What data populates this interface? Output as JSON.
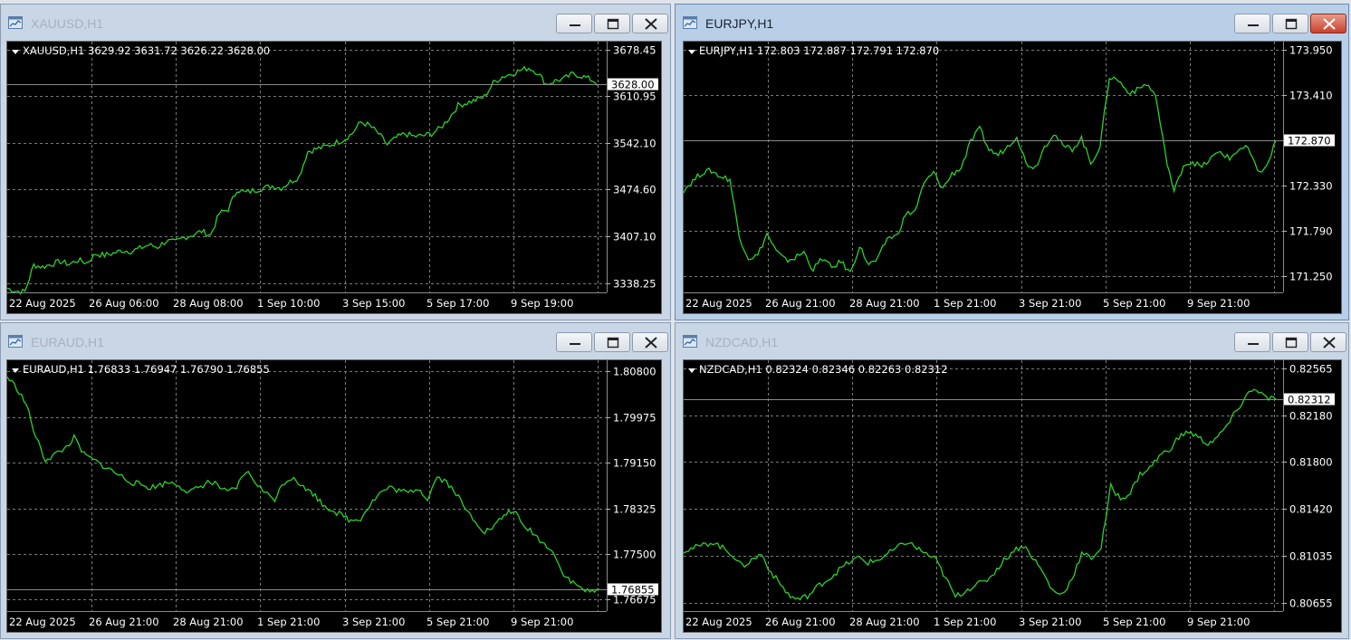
{
  "windows": [
    {
      "id": "xauusd",
      "title": "XAUUSD,H1",
      "active": false,
      "info": "XAUUSD,H1  3629.92 3631.72 3626.22 3628.00",
      "price_axis": [
        "3678.45",
        "3610.95",
        "3542.10",
        "3474.60",
        "3407.10",
        "3338.25"
      ],
      "current_price": "3628.00",
      "time_axis": [
        "22 Aug 2025",
        "26 Aug 06:00",
        "28 Aug 08:00",
        "1 Sep 10:00",
        "3 Sep 15:00",
        "5 Sep 17:00",
        "9 Sep 19:00"
      ],
      "chart_data": {
        "type": "line",
        "series": [
          {
            "values": [
              3331,
              3327,
              3326,
              3365,
              3362,
              3366,
              3370,
              3366,
              3372,
              3368,
              3381,
              3379,
              3382,
              3386,
              3385,
              3389,
              3394,
              3391,
              3400,
              3398,
              3405,
              3409,
              3414,
              3408,
              3440,
              3446,
              3475,
              3470,
              3474,
              3477,
              3480,
              3477,
              3486,
              3493,
              3530,
              3534,
              3537,
              3542,
              3547,
              3556,
              3573,
              3568,
              3556,
              3540,
              3550,
              3556,
              3552,
              3553,
              3556,
              3564,
              3579,
              3597,
              3601,
              3605,
              3610,
              3630,
              3639,
              3643,
              3648,
              3652,
              3645,
              3628,
              3633,
              3636,
              3643,
              3640,
              3635,
              3628
            ]
          }
        ],
        "ylim": [
          3325,
          3690
        ]
      }
    },
    {
      "id": "eurjpy",
      "title": "EURJPY,H1",
      "active": true,
      "info": "EURJPY,H1  172.803 172.887 172.791 172.870",
      "price_axis": [
        "173.950",
        "173.410",
        "172.870",
        "172.330",
        "171.790",
        "171.250"
      ],
      "current_price": "172.870",
      "time_axis": [
        "22 Aug 2025",
        "26 Aug 21:00",
        "28 Aug 21:00",
        "1 Sep 21:00",
        "3 Sep 21:00",
        "5 Sep 21:00",
        "9 Sep 21:00"
      ],
      "chart_data": {
        "type": "line",
        "series": [
          {
            "values": [
              172.28,
              172.39,
              172.49,
              172.51,
              172.44,
              172.41,
              171.73,
              171.47,
              171.5,
              171.76,
              171.55,
              171.44,
              171.47,
              171.54,
              171.33,
              171.47,
              171.35,
              171.43,
              171.29,
              171.61,
              171.39,
              171.45,
              171.71,
              171.73,
              171.99,
              172.03,
              172.36,
              172.49,
              172.3,
              172.47,
              172.55,
              172.85,
              173.01,
              172.76,
              172.7,
              172.8,
              172.93,
              172.6,
              172.55,
              172.8,
              172.96,
              172.8,
              172.77,
              172.9,
              172.6,
              172.8,
              173.63,
              173.59,
              173.45,
              173.47,
              173.55,
              173.41,
              172.74,
              172.25,
              172.58,
              172.62,
              172.55,
              172.66,
              172.74,
              172.65,
              172.77,
              172.78,
              172.5,
              172.55,
              172.87
            ]
          }
        ],
        "ylim": [
          171.06,
          174.05
        ]
      }
    },
    {
      "id": "euraud",
      "title": "EURAUD,H1",
      "active": false,
      "info": "EURAUD,H1  1.76833 1.76947 1.76790 1.76855",
      "price_axis": [
        "1.80800",
        "1.79975",
        "1.79150",
        "1.78325",
        "1.77500",
        "1.76675"
      ],
      "current_price": "1.76855",
      "time_axis": [
        "22 Aug 2025",
        "26 Aug 21:00",
        "28 Aug 21:00",
        "1 Sep 21:00",
        "3 Sep 21:00",
        "5 Sep 21:00",
        "9 Sep 21:00"
      ],
      "chart_data": {
        "type": "line",
        "series": [
          {
            "values": [
              1.807,
              1.805,
              1.802,
              1.796,
              1.792,
              1.793,
              1.794,
              1.796,
              1.793,
              1.792,
              1.791,
              1.79,
              1.789,
              1.788,
              1.7875,
              1.787,
              1.7875,
              1.788,
              1.7875,
              1.786,
              1.787,
              1.788,
              1.7875,
              1.786,
              1.787,
              1.79,
              1.788,
              1.786,
              1.785,
              1.788,
              1.789,
              1.787,
              1.786,
              1.784,
              1.783,
              1.782,
              1.781,
              1.7815,
              1.784,
              1.786,
              1.787,
              1.7865,
              1.786,
              1.787,
              1.785,
              1.789,
              1.788,
              1.786,
              1.783,
              1.781,
              1.779,
              1.78,
              1.782,
              1.783,
              1.78,
              1.779,
              1.777,
              1.776,
              1.772,
              1.77,
              1.769,
              1.768,
              1.7686
            ]
          }
        ],
        "ylim": [
          1.7647,
          1.81
        ]
      }
    },
    {
      "id": "nzdcad",
      "title": "NZDCAD,H1",
      "active": false,
      "info": "NZDCAD,H1  0.82324 0.82346 0.82263 0.82312",
      "price_axis": [
        "0.82565",
        "0.82180",
        "0.81800",
        "0.81420",
        "0.81035",
        "0.80655"
      ],
      "current_price": "0.82312",
      "time_axis": [
        "22 Aug 2025",
        "26 Aug 21:00",
        "28 Aug 21:00",
        "1 Sep 21:00",
        "3 Sep 21:00",
        "5 Sep 21:00",
        "9 Sep 21:00"
      ],
      "chart_data": {
        "type": "line",
        "series": [
          {
            "values": [
              0.8108,
              0.811,
              0.8112,
              0.8115,
              0.811,
              0.8105,
              0.8095,
              0.81,
              0.8105,
              0.809,
              0.808,
              0.807,
              0.8068,
              0.8072,
              0.808,
              0.8085,
              0.8092,
              0.8098,
              0.8102,
              0.8098,
              0.81,
              0.8105,
              0.811,
              0.8115,
              0.811,
              0.8105,
              0.81,
              0.8085,
              0.807,
              0.8075,
              0.808,
              0.8082,
              0.809,
              0.81,
              0.8108,
              0.8112,
              0.8102,
              0.809,
              0.8075,
              0.8072,
              0.8085,
              0.8105,
              0.8102,
              0.811,
              0.816,
              0.815,
              0.8155,
              0.817,
              0.8175,
              0.8185,
              0.819,
              0.82,
              0.8205,
              0.82,
              0.8195,
              0.82,
              0.821,
              0.8222,
              0.8235,
              0.824,
              0.8232,
              0.8231
            ]
          }
        ],
        "ylim": [
          0.80585,
          0.8263
        ]
      }
    }
  ]
}
